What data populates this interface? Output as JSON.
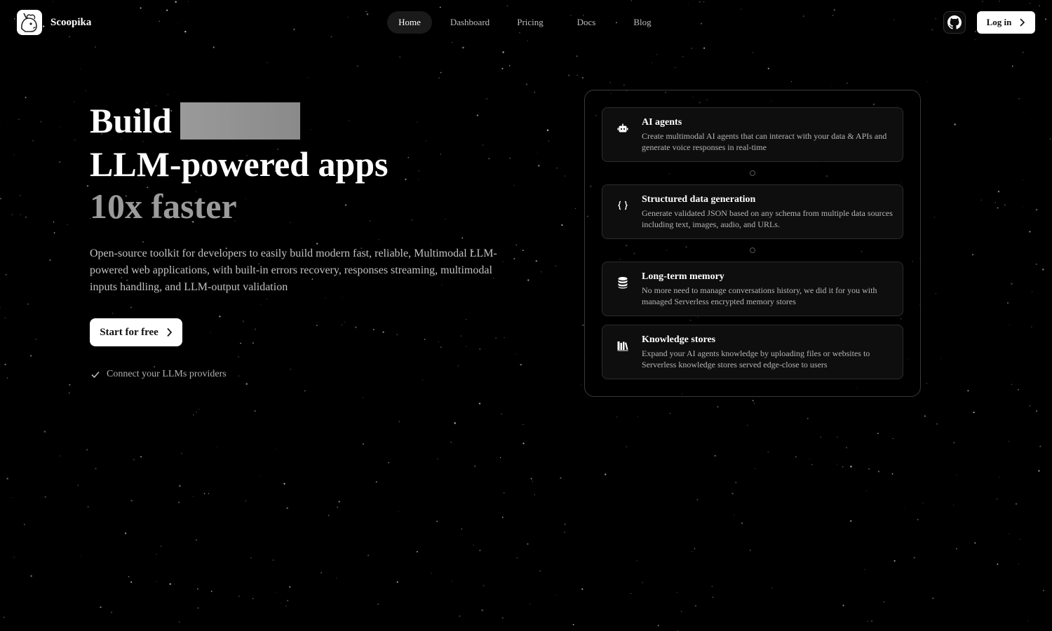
{
  "brand": {
    "name": "Scoopika"
  },
  "nav": {
    "items": [
      {
        "label": "Home",
        "active": true
      },
      {
        "label": "Dashboard",
        "active": false
      },
      {
        "label": "Pricing",
        "active": false
      },
      {
        "label": "Docs",
        "active": false
      },
      {
        "label": "Blog",
        "active": false
      }
    ]
  },
  "header": {
    "login_label": "Log in"
  },
  "hero": {
    "line1": "Build",
    "line2": "LLM-powered apps",
    "line3": "10x faster",
    "subtitle": "Open-source toolkit for developers to easily build modern fast, reliable, Multimodal LLM-powered web applications, with built-in errors recovery, responses streaming, multimodal inputs handling, and LLM-output validation",
    "cta_label": "Start for free",
    "check_text": "Connect your LLMs providers"
  },
  "features": [
    {
      "icon": "robot-icon",
      "title": "AI agents",
      "desc": "Create multimodal AI agents that can interact with your data & APIs and generate voice responses in real-time"
    },
    {
      "icon": "braces-icon",
      "title": "Structured data generation",
      "desc": "Generate validated JSON based on any schema from multiple data sources including text, images, audio, and URLs."
    },
    {
      "icon": "database-icon",
      "title": "Long-term memory",
      "desc": "No more need to manage conversations history, we did it for you with managed Serverless encrypted memory stores"
    },
    {
      "icon": "library-icon",
      "title": "Knowledge stores",
      "desc": "Expand your AI agents knowledge by uploading files or websites to Serverless knowledge stores served edge-close to users"
    }
  ],
  "colors": {
    "background": "#000000",
    "accent": "#ffffff",
    "muted_text": "#b5b5b5",
    "card_border": "#2c2c2c"
  }
}
